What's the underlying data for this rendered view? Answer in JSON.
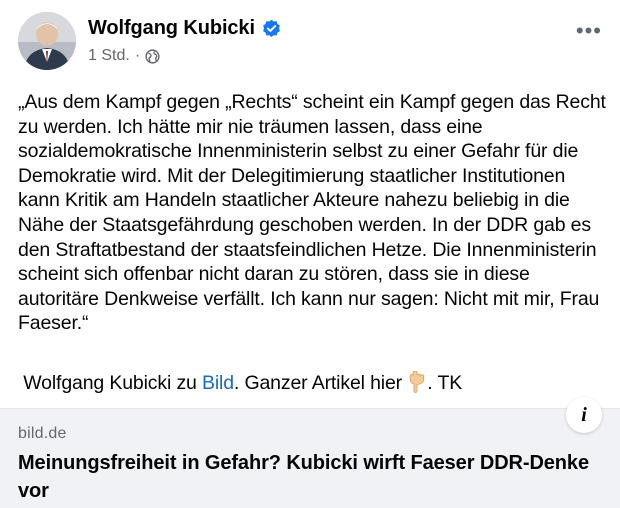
{
  "post": {
    "author": "Wolfgang Kubicki",
    "time": "1 Std.",
    "separator": "·",
    "menu_icon": "more-horizontal-icon",
    "text": "„Aus dem Kampf gegen „Rechts“ scheint ein Kampf gegen das Recht zu werden. Ich hätte mir nie träumen lassen, dass eine sozialdemokratische Innenministerin selbst zu einer Gefahr für die Demokratie wird. Mit der Delegitimierung staatlicher Institutionen kann Kritik am Handeln staatlicher Akteure nahezu beliebig in die Nähe der Staatsgefährdung geschoben werden. In der DDR gab es den Straftatbestand der staatsfeindlichen Hetze. Die Innenministerin scheint sich offenbar nicht daran zu stören, dass sie in diese autoritäre Denkweise verfällt. Ich kann nur sagen: Nicht mit mir, Frau Faeser.“",
    "attribution_prefix": " Wolfgang Kubicki zu ",
    "attribution_link": "Bild",
    "attribution_middle": ". Ganzer Artikel hier ",
    "attribution_suffix": ". TK"
  },
  "link_card": {
    "domain": "bild.de",
    "headline": "Meinungsfreiheit in Gefahr? Kubicki wirft Faeser DDR-Denke vor",
    "info_label": "i"
  },
  "colors": {
    "link": "#1b6ac9",
    "verified": "#1877f2",
    "secondary_text": "#65676b",
    "card_bg": "#f0f2f5"
  }
}
